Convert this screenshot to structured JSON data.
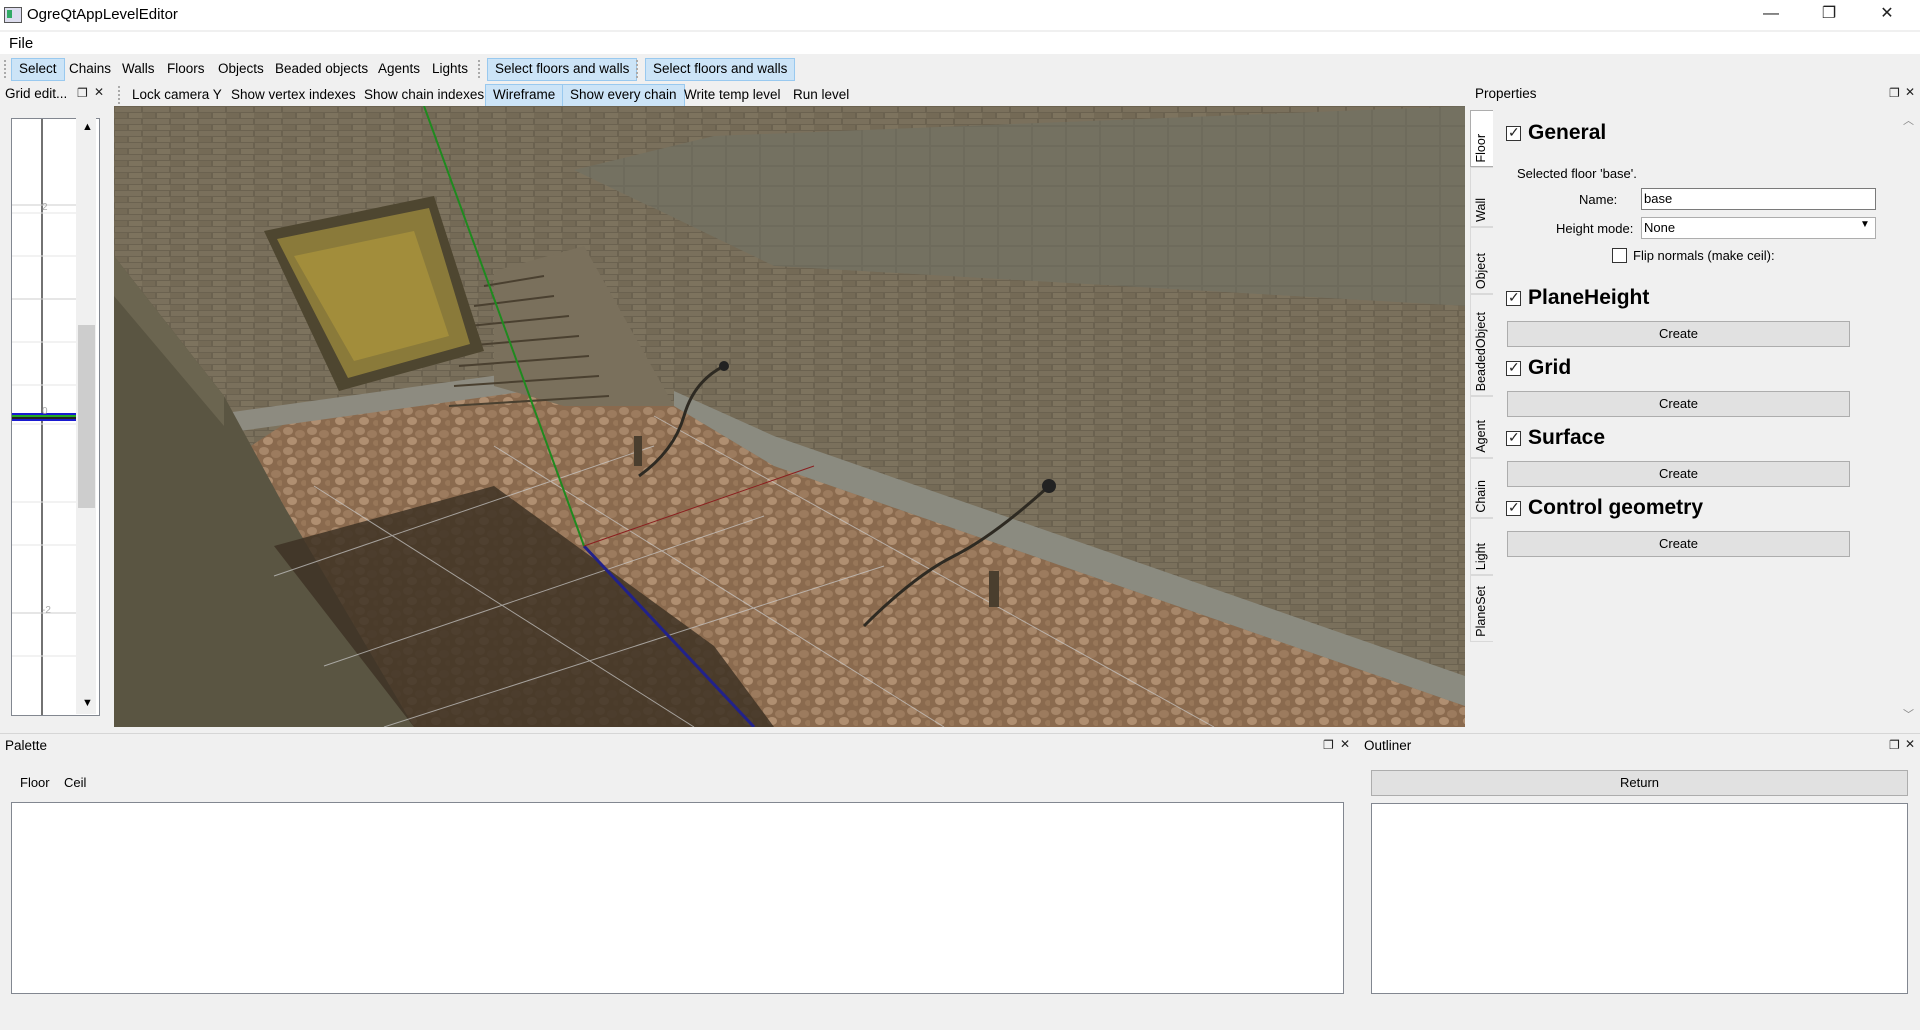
{
  "window": {
    "title": "OgreQtAppLevelEditor",
    "minimize_glyph": "—",
    "restore_glyph": "❐",
    "close_glyph": "✕"
  },
  "menu": {
    "file": "File"
  },
  "toolbar": {
    "items": [
      "Select",
      "Chains",
      "Walls",
      "Floors",
      "Objects",
      "Beaded objects",
      "Agents",
      "Lights"
    ],
    "select_floors_walls_1": "Select floors and walls",
    "select_floors_walls_2": "Select floors and walls"
  },
  "grid_editor": {
    "title": "Grid edit...",
    "tick_labels": [
      "2",
      "0",
      "-2"
    ]
  },
  "view_toolbar": {
    "lock_camera_y": "Lock camera Y",
    "show_vertex_indexes": "Show vertex indexes",
    "show_chain_indexes": "Show chain indexes",
    "wireframe": "Wireframe",
    "show_every_chain": "Show every chain",
    "write_temp_level": "Write temp level",
    "run_level": "Run level"
  },
  "properties": {
    "title": "Properties",
    "tabs": [
      "Floor",
      "Wall",
      "Object",
      "BeadedObject",
      "Agent",
      "Chain",
      "Light",
      "PlaneSet"
    ],
    "general": {
      "title": "General",
      "selected_text": "Selected floor 'base'.",
      "name_label": "Name:",
      "name_value": "base",
      "height_mode_label": "Height mode:",
      "height_mode_value": "None",
      "flip_normals_label": "Flip normals (make ceil):"
    },
    "sections": [
      {
        "title": "PlaneHeight",
        "button": "Create"
      },
      {
        "title": "Grid",
        "button": "Create"
      },
      {
        "title": "Surface",
        "button": "Create"
      },
      {
        "title": "Control geometry",
        "button": "Create"
      }
    ]
  },
  "palette": {
    "title": "Palette",
    "tabs": [
      "Floor",
      "Ceil"
    ]
  },
  "outliner": {
    "title": "Outliner",
    "return_button": "Return"
  },
  "colors": {
    "selection_bg": "#cce4f7",
    "selection_border": "#99c9ef",
    "window_bg": "#f0f0f0"
  },
  "icons": {
    "float": "float-icon",
    "close": "close-icon",
    "dropdown": "chevron-down-icon"
  }
}
